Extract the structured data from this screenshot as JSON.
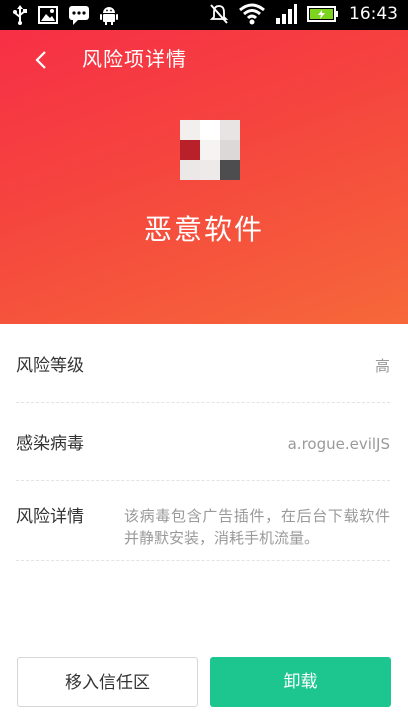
{
  "status_bar": {
    "time": "16:43",
    "icons": [
      "usb-icon",
      "image-icon",
      "message-icon",
      "android-icon",
      "mute-icon",
      "wifi-icon",
      "signal-icon",
      "battery-icon"
    ]
  },
  "header": {
    "title": "风险项详情",
    "back_icon": "chevron-left-icon",
    "app_name": "恶意软件",
    "app_icon": "mosaic-app-icon"
  },
  "details": [
    {
      "label": "风险等级",
      "value": "高"
    },
    {
      "label": "感染病毒",
      "value": "a.rogue.evilJS"
    },
    {
      "label": "风险详情",
      "value": "该病毒包含广告插件，在后台下载软件并静默安装，消耗手机流量。"
    }
  ],
  "actions": {
    "trust_label": "移入信任区",
    "uninstall_label": "卸载"
  },
  "colors": {
    "header_gradient_start": "#f72f46",
    "header_gradient_end": "#f6683a",
    "uninstall_button": "#1dc58f"
  }
}
